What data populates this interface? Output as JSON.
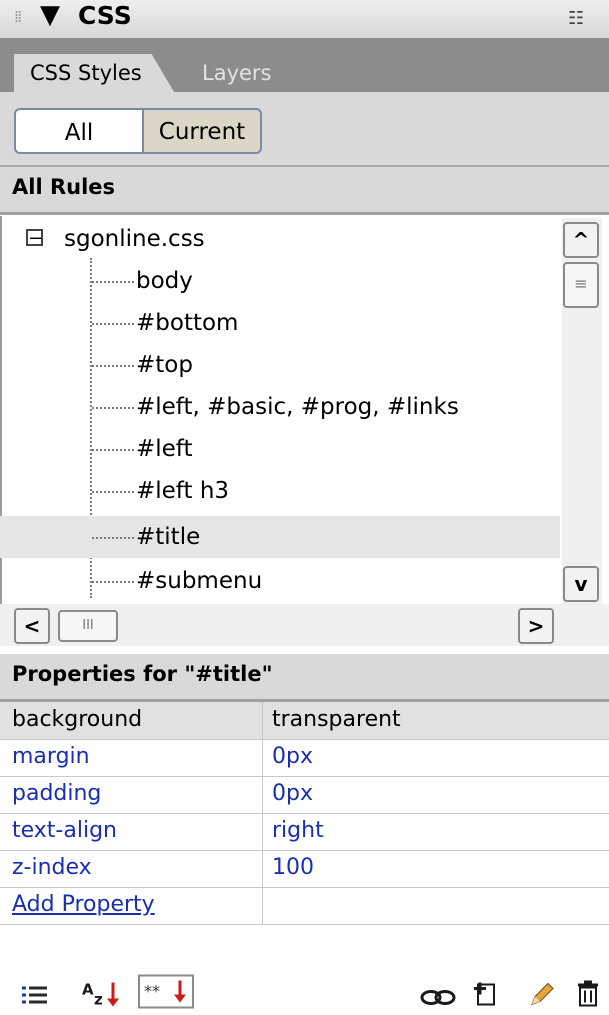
{
  "titlebar": {
    "title": "CSS",
    "collapse_glyph": "▼",
    "grip_glyph": "⁞⁞",
    "menu_glyph": "☷"
  },
  "tabs": [
    {
      "label": "CSS Styles",
      "active": true
    },
    {
      "label": "Layers",
      "active": false
    }
  ],
  "mode_toggle": {
    "all_label": "All",
    "current_label": "Current",
    "selected": "All"
  },
  "rules_section": {
    "header": "All Rules"
  },
  "tree": {
    "root": {
      "label": "sgonline.css",
      "expanded": true,
      "toggle_glyph": "−"
    },
    "items": [
      {
        "label": "body"
      },
      {
        "label": "#bottom"
      },
      {
        "label": "#top"
      },
      {
        "label": "#left, #basic, #prog, #links"
      },
      {
        "label": "#left"
      },
      {
        "label": "#left h3"
      },
      {
        "label": "#title",
        "selected": true
      },
      {
        "label": "#submenu"
      }
    ]
  },
  "scrollbars": {
    "up": "^",
    "down": "v",
    "left": "<",
    "right": ">",
    "grip_v": "≡",
    "grip_h": "III"
  },
  "properties": {
    "header": "Properties for \"#title\"",
    "rows": [
      {
        "name": "background",
        "value": "transparent"
      },
      {
        "name": "margin",
        "value": "0px"
      },
      {
        "name": "padding",
        "value": "0px"
      },
      {
        "name": "text-align",
        "value": "right"
      },
      {
        "name": "z-index",
        "value": "100"
      }
    ],
    "add_property": "Add Property"
  },
  "toolbar": {
    "left_icons": [
      "show-category-view-icon",
      "show-alphabetical-view-icon",
      "show-set-properties-icon"
    ],
    "right_icons": [
      "attach-style-sheet-icon",
      "new-css-rule-icon",
      "edit-style-icon",
      "delete-css-rule-icon"
    ]
  },
  "colors": {
    "link_blue": "#1a2fb0",
    "tab_strip": "#8c8c8c",
    "panel_gray": "#d9d9d9"
  }
}
